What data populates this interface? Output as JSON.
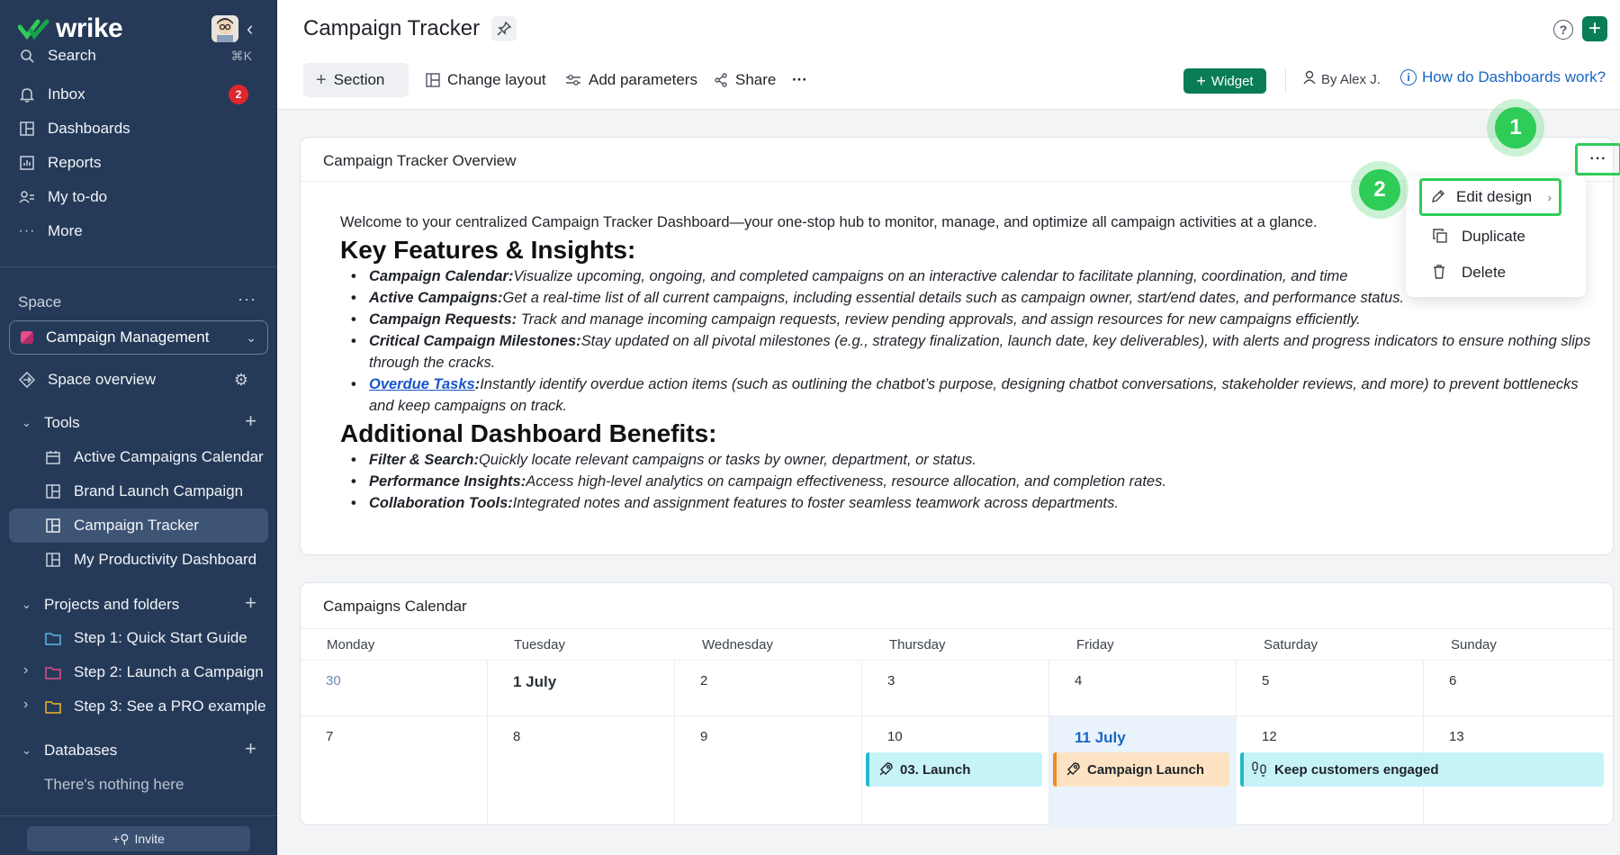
{
  "app": {
    "name": "wrike"
  },
  "sidebar": {
    "search_label": "Search",
    "search_shortcut": "⌘K",
    "inbox_label": "Inbox",
    "inbox_count": "2",
    "dashboards_label": "Dashboards",
    "reports_label": "Reports",
    "todo_label": "My to-do",
    "more_label": "More",
    "space_title": "Space",
    "space_name": "Campaign Management",
    "space_overview": "Space overview",
    "tools_title": "Tools",
    "tools": [
      {
        "label": "Active Campaigns Calendar",
        "icon": "calendar-icon"
      },
      {
        "label": "Brand Launch Campaign",
        "icon": "dashboard-icon"
      },
      {
        "label": "Campaign Tracker",
        "icon": "dashboard-icon"
      },
      {
        "label": "My Productivity Dashboard",
        "icon": "dashboard-icon"
      }
    ],
    "projects_title": "Projects and folders",
    "projects": [
      {
        "label": "Step 1: Quick Start Guide",
        "color": "#5ab4e8"
      },
      {
        "label": "Step 2: Launch a Campaign",
        "color": "#e54c8a"
      },
      {
        "label": "Step 3: See a PRO example",
        "color": "#f0b429"
      }
    ],
    "databases_title": "Databases",
    "databases_empty": "There's nothing here",
    "invite_label": "Invite"
  },
  "header": {
    "title": "Campaign Tracker",
    "section_btn": "Section",
    "change_layout": "Change layout",
    "add_parameters": "Add parameters",
    "share": "Share",
    "more": "···",
    "widget_btn": "Widget",
    "by_user": "By Alex J.",
    "help_link": "How do Dashboards work?"
  },
  "overview": {
    "title": "Campaign Tracker Overview",
    "intro": "Welcome to your centralized Campaign Tracker Dashboard—your one-stop hub to monitor, manage, and optimize all campaign activities at a glance.",
    "heading1": "Key Features & Insights:",
    "features": [
      {
        "term": "Campaign Calendar:",
        "text": "Visualize upcoming, ongoing, and completed campaigns on an interactive calendar to facilitate planning, coordination, and time"
      },
      {
        "term": "Active Campaigns:",
        "text": "Get a real-time list of all current campaigns, including essential details such as campaign owner, start/end dates, and performance status."
      },
      {
        "term": "Campaign Requests:",
        "text": " Track and manage incoming campaign requests, review pending approvals, and assign resources for new campaigns efficiently."
      },
      {
        "term": "Critical Campaign Milestones:",
        "text": "Stay updated on all pivotal milestones (e.g., strategy finalization, launch date, key deliverables), with alerts and progress indicators to ensure nothing slips through the cracks."
      },
      {
        "term": "Overdue Tasks",
        "term_suffix": ":",
        "text": "Instantly identify overdue action items (such as outlining the chatbot’s purpose, designing chatbot conversations, stakeholder reviews, and more) to prevent bottlenecks and keep campaigns on track."
      }
    ],
    "heading2": "Additional Dashboard Benefits:",
    "benefits": [
      {
        "term": "Filter & Search:",
        "text": "Quickly locate relevant campaigns or tasks by owner, department, or status."
      },
      {
        "term": "Performance Insights:",
        "text": "Access high-level analytics on campaign effectiveness, resource allocation, and completion rates."
      },
      {
        "term": "Collaboration Tools:",
        "text": "Integrated notes and assignment features to foster seamless teamwork across departments."
      }
    ]
  },
  "menu": {
    "edit_design": "Edit design",
    "duplicate": "Duplicate",
    "delete": "Delete"
  },
  "steps": {
    "one": "1",
    "two": "2"
  },
  "calendar": {
    "title": "Campaigns Calendar",
    "days": [
      "Monday",
      "Tuesday",
      "Wednesday",
      "Thursday",
      "Friday",
      "Saturday",
      "Sunday"
    ],
    "week1": [
      "30",
      "1 July",
      "2",
      "3",
      "4",
      "5",
      "6"
    ],
    "week2": [
      "7",
      "8",
      "9",
      "10",
      "11 July",
      "12",
      "13"
    ],
    "events": [
      {
        "label": "03. Launch",
        "icon": "rocket-icon"
      },
      {
        "label": "Campaign Launch",
        "icon": "rocket-icon"
      },
      {
        "label": "Keep customers engaged",
        "icon": "footprints-icon"
      }
    ]
  },
  "colors": {
    "brand": "#0a7d54",
    "sidebar": "#253a58",
    "highlight": "#2fcc58",
    "link": "#1a66c2"
  }
}
